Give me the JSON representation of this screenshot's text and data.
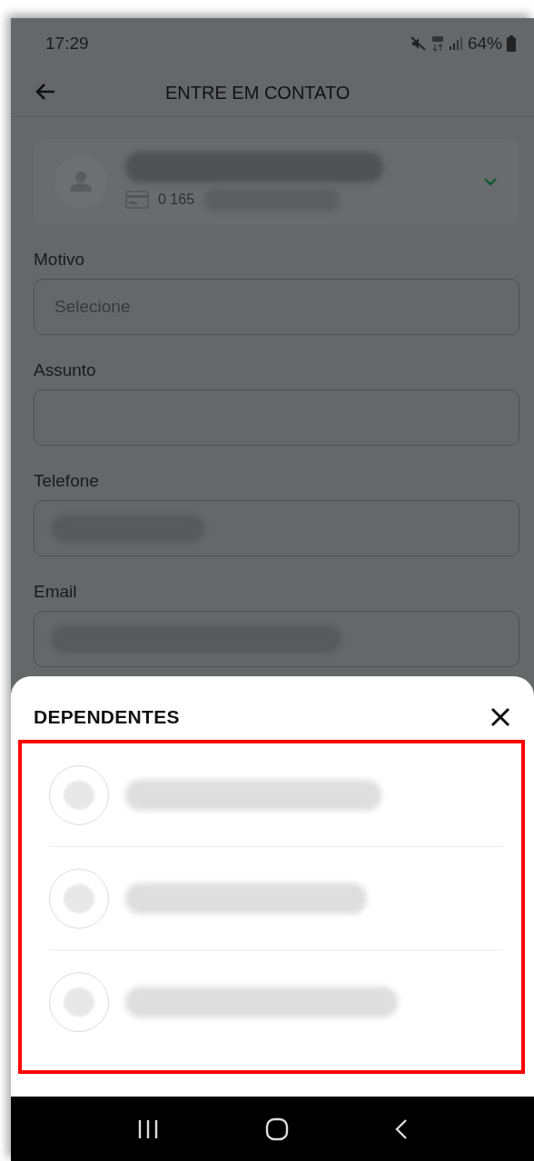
{
  "status_bar": {
    "time": "17:29",
    "battery": "64%"
  },
  "header": {
    "title": "ENTRE EM CONTATO"
  },
  "account_card": {
    "number": "0 165"
  },
  "form": {
    "fields": [
      {
        "label": "Motivo",
        "placeholder": "Selecione",
        "redacted": false
      },
      {
        "label": "Assunto",
        "redacted": false
      },
      {
        "label": "Telefone",
        "redacted": true
      },
      {
        "label": "Email",
        "redacted": true
      }
    ]
  },
  "sheet": {
    "title": "DEPENDENTES",
    "highlighted": true,
    "dependents": [
      {
        "selected": false
      },
      {
        "selected": false
      },
      {
        "selected": false
      }
    ]
  }
}
